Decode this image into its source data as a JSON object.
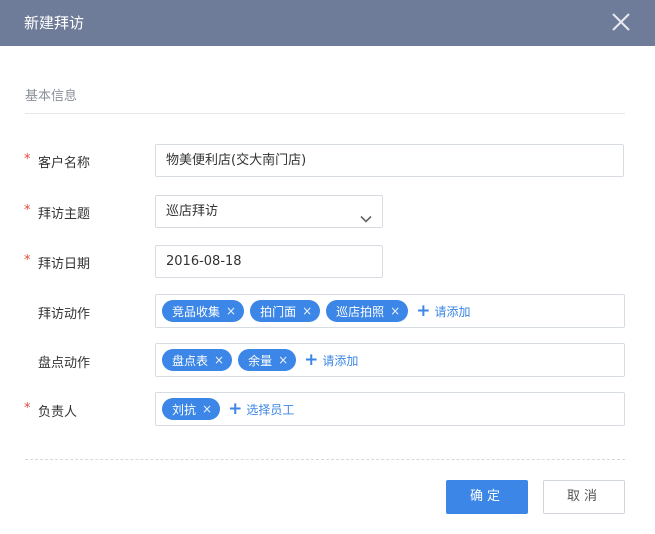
{
  "dialog": {
    "title": "新建拜访"
  },
  "section": {
    "title": "基本信息"
  },
  "form": {
    "required_mark": "*",
    "customer": {
      "label": "客户名称",
      "value": "物美便利店(交大南门店)"
    },
    "topic": {
      "label": "拜访主题",
      "value": "巡店拜访"
    },
    "date": {
      "label": "拜访日期",
      "value": "2016-08-18"
    },
    "actions": {
      "label": "拜访动作",
      "tags": [
        "竞品收集",
        "拍门面",
        "巡店拍照"
      ],
      "add_label": "请添加"
    },
    "inventory": {
      "label": "盘点动作",
      "tags": [
        "盘点表",
        "余量"
      ],
      "add_label": "请添加"
    },
    "owner": {
      "label": "负责人",
      "tags": [
        "刘抗"
      ],
      "add_label": "选择员工"
    }
  },
  "tag_remove_glyph": "×",
  "add_glyph": "+",
  "buttons": {
    "ok": "确定",
    "cancel": "取消"
  },
  "colors": {
    "header_bg": "#6f7c99",
    "accent": "#3b86e6",
    "required": "#e14b3b"
  }
}
